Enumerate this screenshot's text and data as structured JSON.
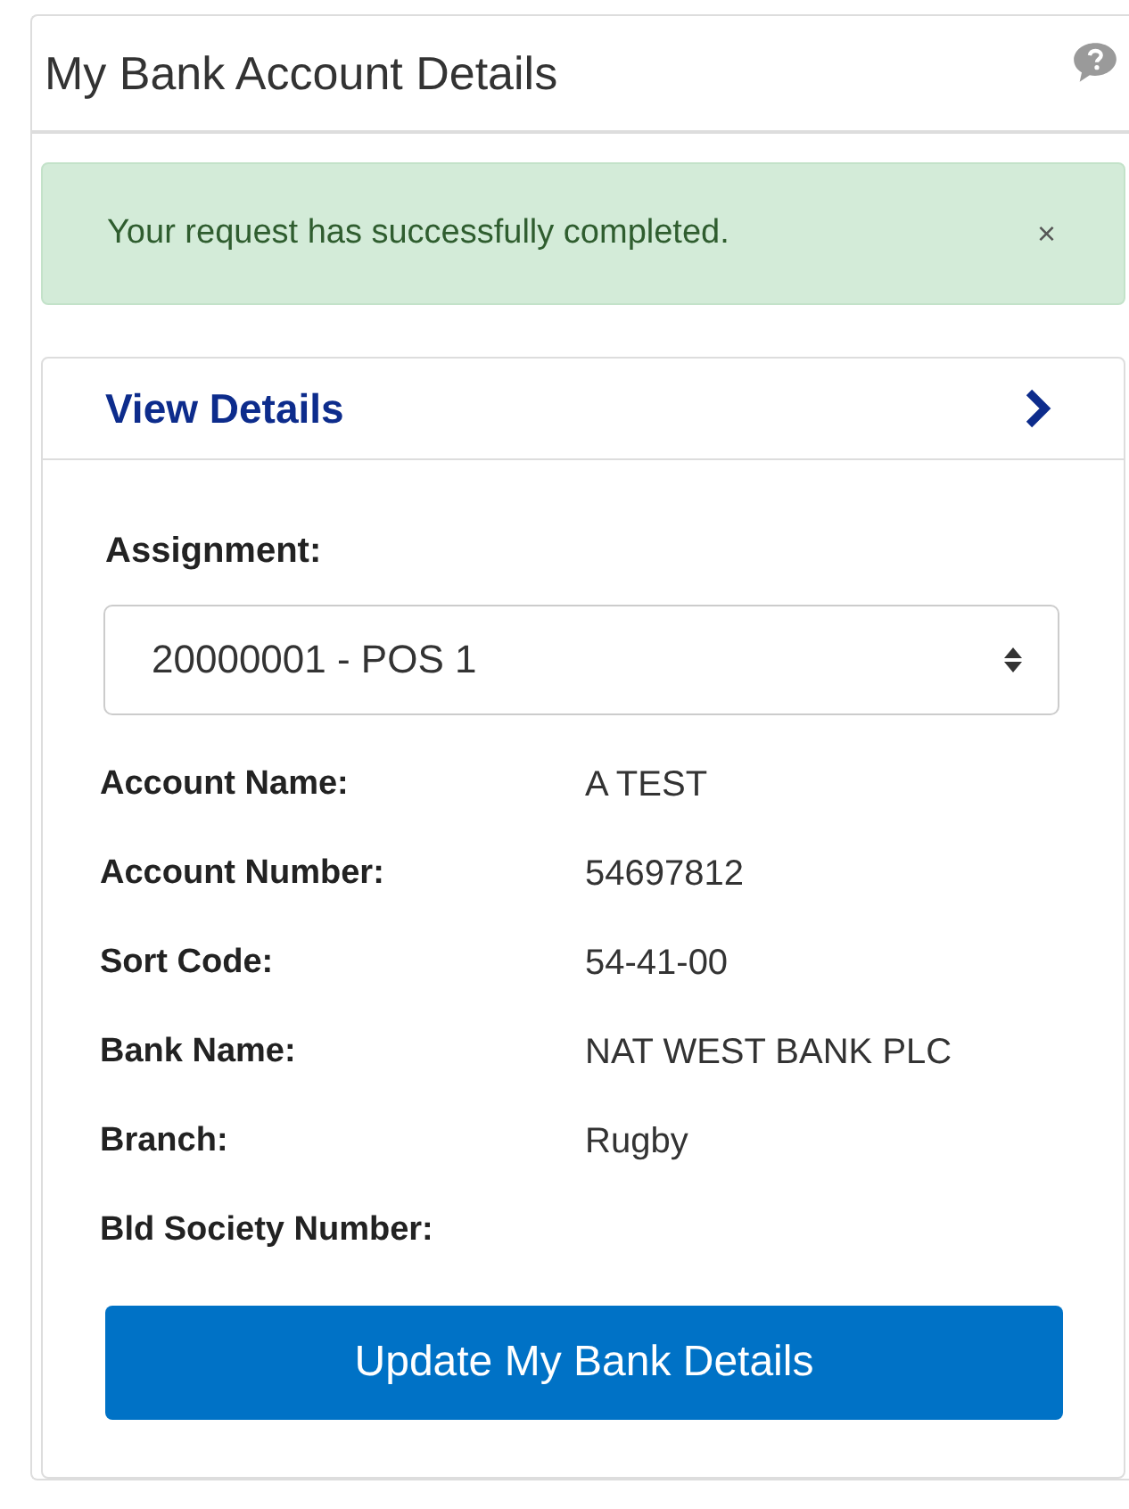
{
  "panel": {
    "title": "My Bank Account Details"
  },
  "alert": {
    "message": "Your request has successfully completed.",
    "close": "×"
  },
  "card": {
    "title": "View Details",
    "expanded": false
  },
  "assignment": {
    "label": "Assignment:",
    "value": "20000001 - POS 1"
  },
  "details": [
    {
      "label": "Account Name:",
      "value": "A TEST"
    },
    {
      "label": "Account Number:",
      "value": "54697812"
    },
    {
      "label": "Sort Code:",
      "value": "54-41-00"
    },
    {
      "label": "Bank Name:",
      "value": "NAT WEST BANK PLC"
    },
    {
      "label": "Branch:",
      "value": "Rugby"
    },
    {
      "label": "Bld Society Number:"
    }
  ],
  "buttons": [
    "Update My Bank Details"
  ]
}
